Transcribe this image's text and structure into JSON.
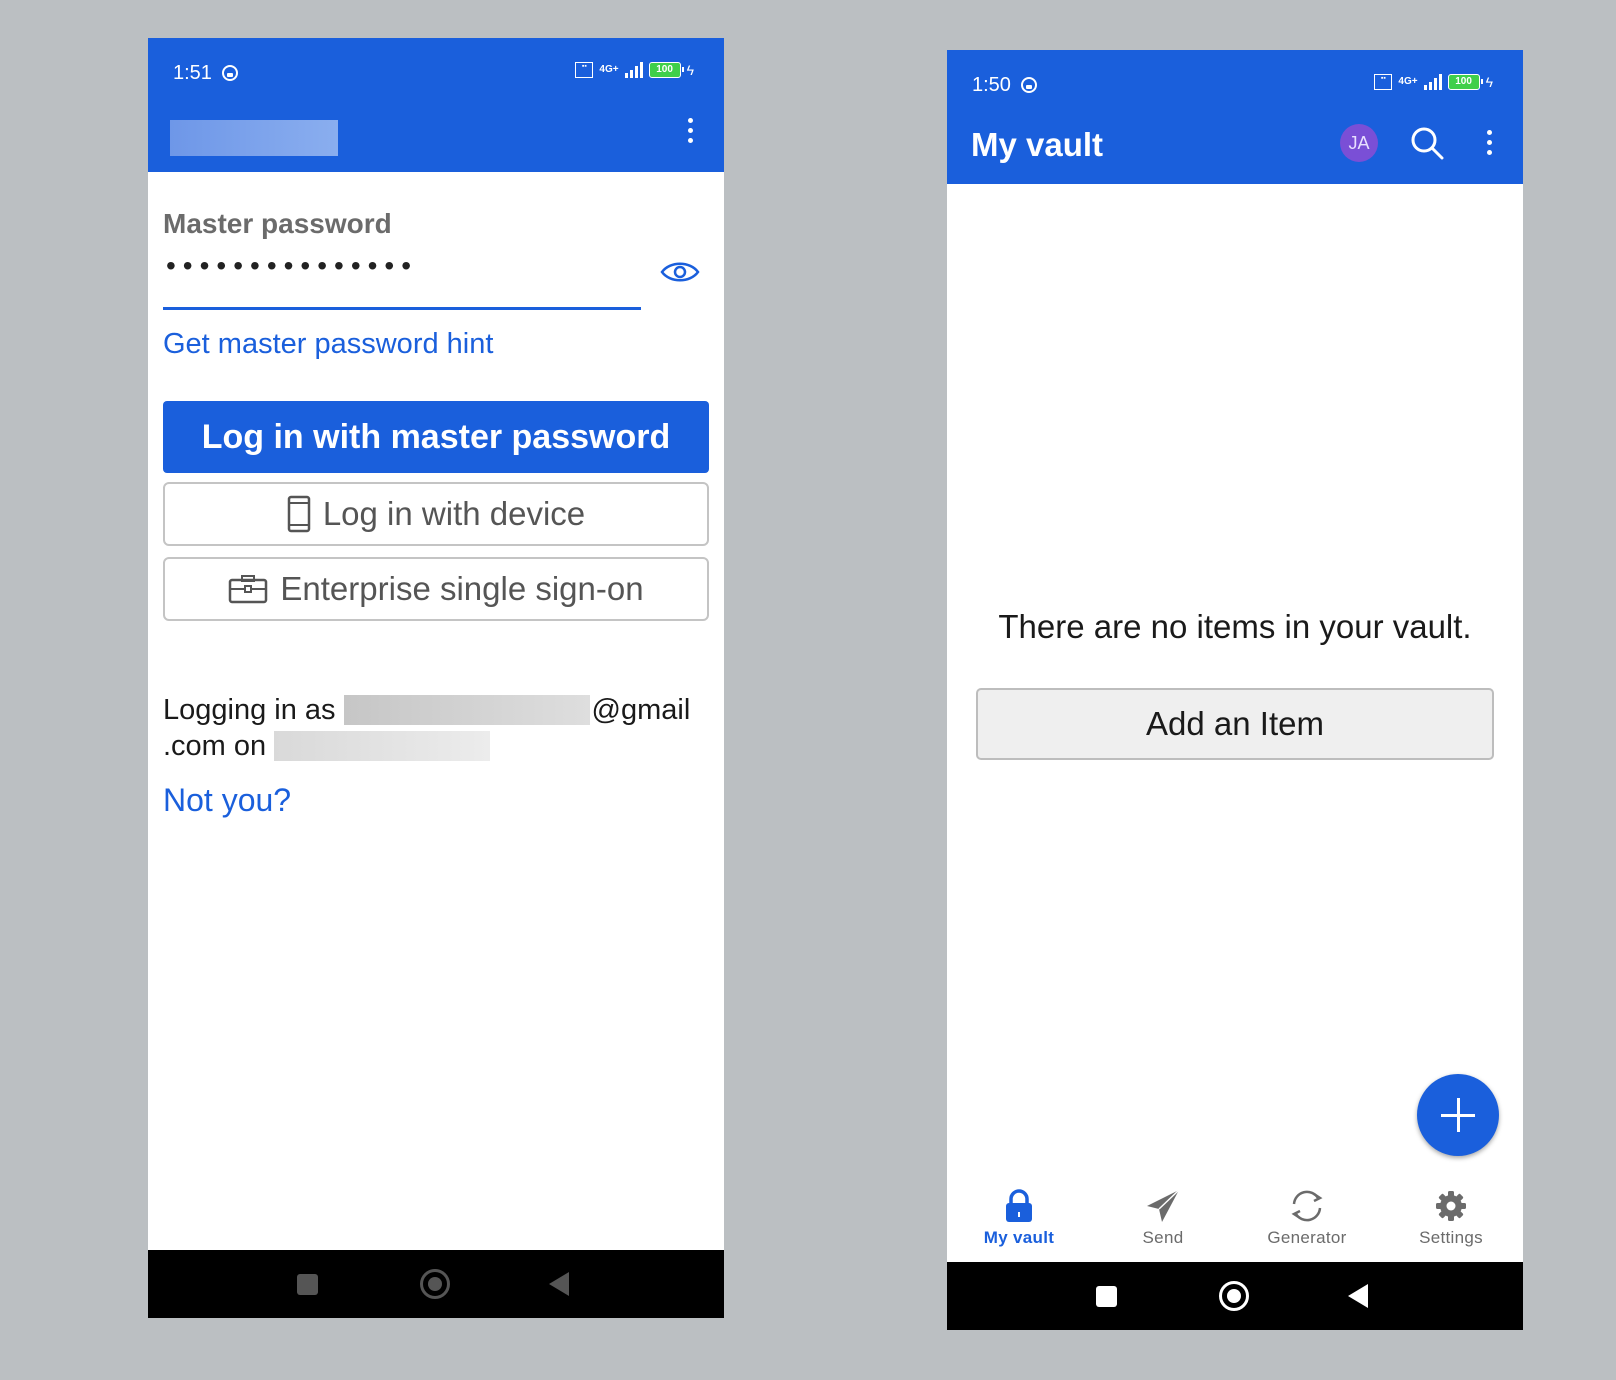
{
  "login_screen": {
    "status_time": "1:51",
    "battery": "100",
    "network": "4G+",
    "field_label": "Master password",
    "password_masked": "•••••••••••••••",
    "hint_link": "Get master password hint",
    "login_master_label": "Log in with master password",
    "login_device_label": "Log in with device",
    "sso_label": "Enterprise single sign-on",
    "logging_in_as_prefix": "Logging in as",
    "email_suffix": "@gmail",
    "on_prefix": ".com on",
    "not_you": "Not you?"
  },
  "vault_screen": {
    "status_time": "1:50",
    "battery": "100",
    "network": "4G+",
    "title": "My vault",
    "avatar_initials": "JA",
    "empty_message": "There are no items in your vault.",
    "add_item_label": "Add an Item",
    "tabs": [
      {
        "label": "My vault",
        "icon": "lock-icon",
        "active": true
      },
      {
        "label": "Send",
        "icon": "paper-plane-icon",
        "active": false
      },
      {
        "label": "Generator",
        "icon": "refresh-icon",
        "active": false
      },
      {
        "label": "Settings",
        "icon": "gear-icon",
        "active": false
      }
    ]
  },
  "colors": {
    "brand_blue": "#1a5fdc",
    "background": "#bbbfc2",
    "avatar": "#7a4fd6"
  }
}
